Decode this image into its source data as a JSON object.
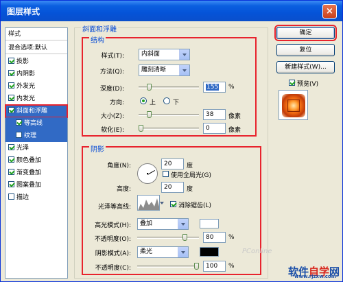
{
  "window": {
    "title": "图层样式",
    "close_glyph": "×"
  },
  "left_panel": {
    "header": "样式",
    "blend_options": "混合选项:默认",
    "items": [
      {
        "label": "投影",
        "checked": true
      },
      {
        "label": "内阴影",
        "checked": true
      },
      {
        "label": "外发光",
        "checked": true
      },
      {
        "label": "内发光",
        "checked": true
      },
      {
        "label": "斜面和浮雕",
        "checked": true,
        "selected": true
      },
      {
        "label": "等高线",
        "checked": true,
        "sub": true
      },
      {
        "label": "纹理",
        "checked": false,
        "sub": true
      },
      {
        "label": "光泽",
        "checked": true
      },
      {
        "label": "颜色叠加",
        "checked": true
      },
      {
        "label": "渐变叠加",
        "checked": true
      },
      {
        "label": "图案叠加",
        "checked": true
      },
      {
        "label": "描边",
        "checked": false
      }
    ]
  },
  "bevel": {
    "section_title": "斜面和浮雕",
    "structure": {
      "title": "结构",
      "style": {
        "label": "样式(T):",
        "value": "内斜面"
      },
      "technique": {
        "label": "方法(Q):",
        "value": "雕刻清晰"
      },
      "depth": {
        "label": "深度(D):",
        "value": "155",
        "unit": "%",
        "fraction": 0.15
      },
      "direction": {
        "label": "方向:",
        "up": "上",
        "down": "下",
        "selected": "上"
      },
      "size": {
        "label": "大小(Z):",
        "value": "38",
        "unit": "像素",
        "fraction": 0.15
      },
      "soften": {
        "label": "软化(E):",
        "value": "0",
        "unit": "像素",
        "fraction": 0.0
      }
    },
    "shading": {
      "title": "阴影",
      "angle": {
        "label": "角度(N):",
        "value": "20",
        "unit": "度"
      },
      "global_light": {
        "label": "使用全局光(G)",
        "checked": false
      },
      "altitude": {
        "label": "高度:",
        "value": "20",
        "unit": "度"
      },
      "gloss_contour": {
        "label": "光泽等高线:"
      },
      "anti_aliased": {
        "label": "消除锯齿(L)",
        "checked": true
      },
      "highlight_mode": {
        "label": "高光模式(H):",
        "value": "叠加",
        "color": "#ffffff"
      },
      "highlight_opacity": {
        "label": "不透明度(O):",
        "value": "80",
        "unit": "%",
        "fraction": 0.8
      },
      "shadow_mode": {
        "label": "阴影模式(A):",
        "value": "柔光",
        "color": "#000000"
      },
      "shadow_opacity": {
        "label": "不透明度(C):",
        "value": "100",
        "unit": "%",
        "fraction": 1.0
      }
    }
  },
  "buttons": {
    "ok": "确定",
    "reset": "复位",
    "new_style": "新建样式(W)...",
    "preview": {
      "label": "预览(V)",
      "checked": true
    }
  },
  "watermark": {
    "text_prefix": "软件",
    "text_red": "自学",
    "text_suffix": "网",
    "url": "www.rjzxw.com",
    "faint": "PConline"
  }
}
